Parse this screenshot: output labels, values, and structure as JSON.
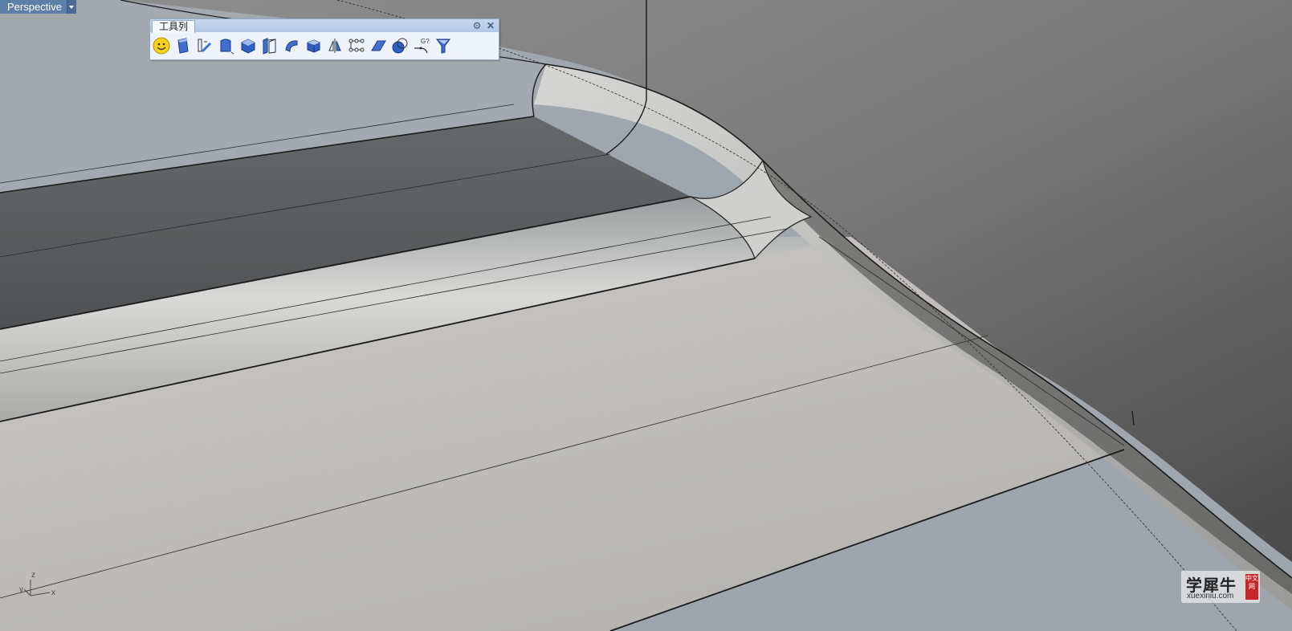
{
  "viewport": {
    "name": "Perspective",
    "axes": {
      "x": "x",
      "y": "y",
      "z": "z"
    }
  },
  "toolbar": {
    "title": "工具列",
    "tools": [
      "smiley-icon",
      "extrude-surface-icon",
      "sweep-rail-icon",
      "surface-from-curves-icon",
      "box-solid-icon",
      "loft-icon",
      "revolve-icon",
      "solid-cube-icon",
      "mirror-icon",
      "array-icon",
      "plane-surface-icon",
      "boolean-icon",
      "continuity-check-icon",
      "funnel-filter-icon"
    ],
    "g_label": "G?"
  },
  "watermark": {
    "main": "学犀牛",
    "sub": "xuexiniu.com",
    "seal": "中文网"
  },
  "colors": {
    "label_bg": "#5c7fa8",
    "toolbar_bg": "#eef3fb",
    "seal": "#c9262b"
  }
}
